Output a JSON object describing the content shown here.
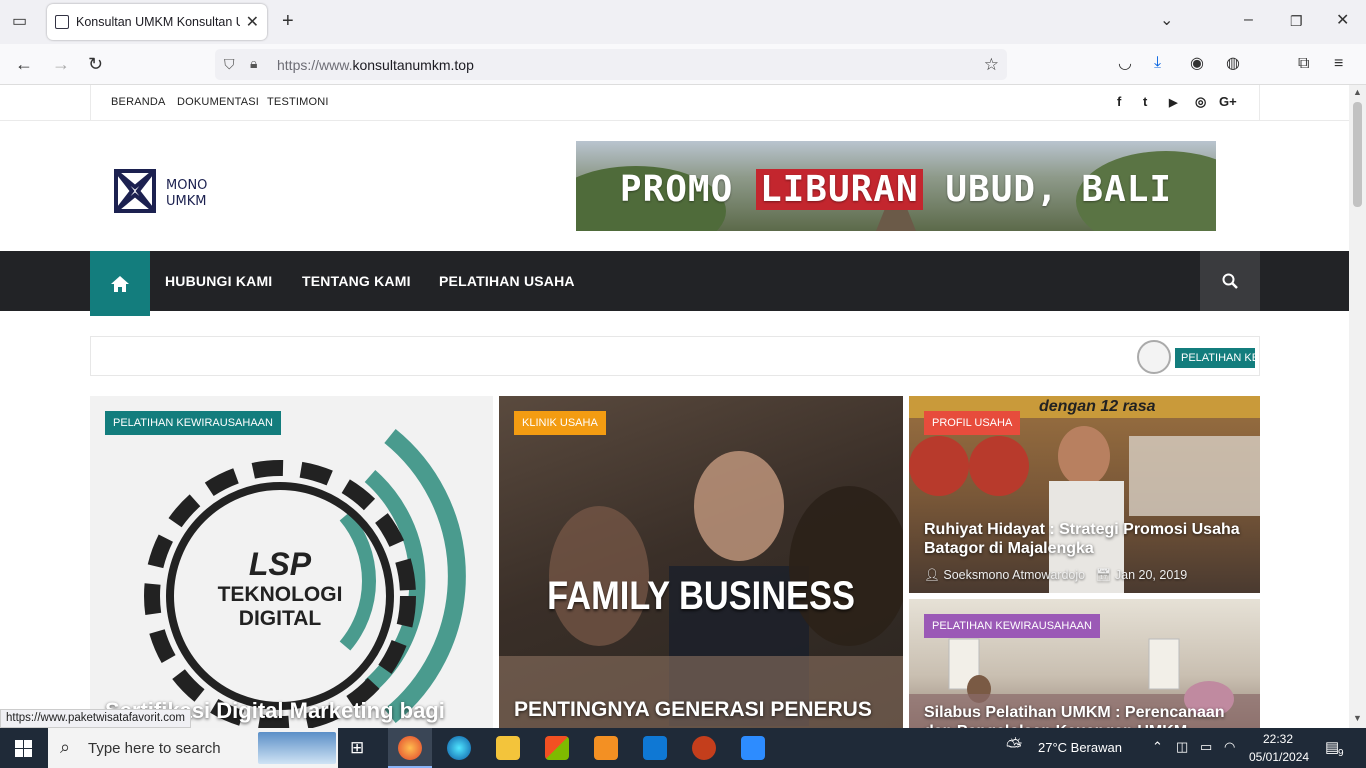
{
  "browser": {
    "tab_title": "Konsultan UMKM Konsultan UMKM",
    "url_prefix": "https://www.",
    "url_domain": "konsultanumkm.top",
    "status_url": "https://www.paketwisatafavorit.com"
  },
  "site": {
    "top_nav": [
      "BERANDA",
      "DOKUMENTASI",
      "TESTIMONI"
    ],
    "social_icons": [
      "facebook-icon",
      "twitter-icon",
      "youtube-icon",
      "instagram-icon",
      "google-plus-icon"
    ],
    "social_glyphs": [
      "f",
      "t",
      "▶",
      "◎",
      "G+"
    ],
    "logo_line1": "MONO",
    "logo_line2": "UMKM",
    "banner_pre": "PROMO ",
    "banner_highlight": "LIBURAN",
    "banner_post": " UBUD, BALI",
    "main_nav": [
      "HUBUNGI KAMI",
      "TENTANG KAMI",
      "PELATIHAN USAHA"
    ],
    "ticker_label": "PELATIHAN KE"
  },
  "cards": [
    {
      "category": "PELATIHAN KEWIRAUSAHAAN",
      "category_color": "#137d7d",
      "image_text_1": "LSP",
      "image_text_2": "TEKNOLOGI",
      "image_text_3": "DIGITAL",
      "title": "Sertifikasi Digital Marketing bagi"
    },
    {
      "category": "KLINIK USAHA",
      "category_color": "#f39c12",
      "image_text": "FAMILY BUSINESS",
      "title": "PENTINGNYA GENERASI PENERUS"
    },
    {
      "category": "PROFIL USAHA",
      "category_color": "#e74c3c",
      "image_text": "dengan 12 rasa",
      "title": "Ruhiyat Hidayat : Strategi Promosi Usaha Batagor di Majalengka",
      "author": "Soeksmono Atmowardojo",
      "date": "Jan 20, 2019"
    },
    {
      "category": "PELATIHAN KEWIRAUSAHAAN",
      "category_color": "#9b59b6",
      "title": "Silabus Pelatihan UMKM : Perencanaan dan Pengelolaan Keuangan UMKM"
    }
  ],
  "taskbar": {
    "search_placeholder": "Type here to search",
    "weather": "27°C  Berawan",
    "time": "22:32",
    "date": "05/01/2024",
    "notification_count": "9"
  }
}
